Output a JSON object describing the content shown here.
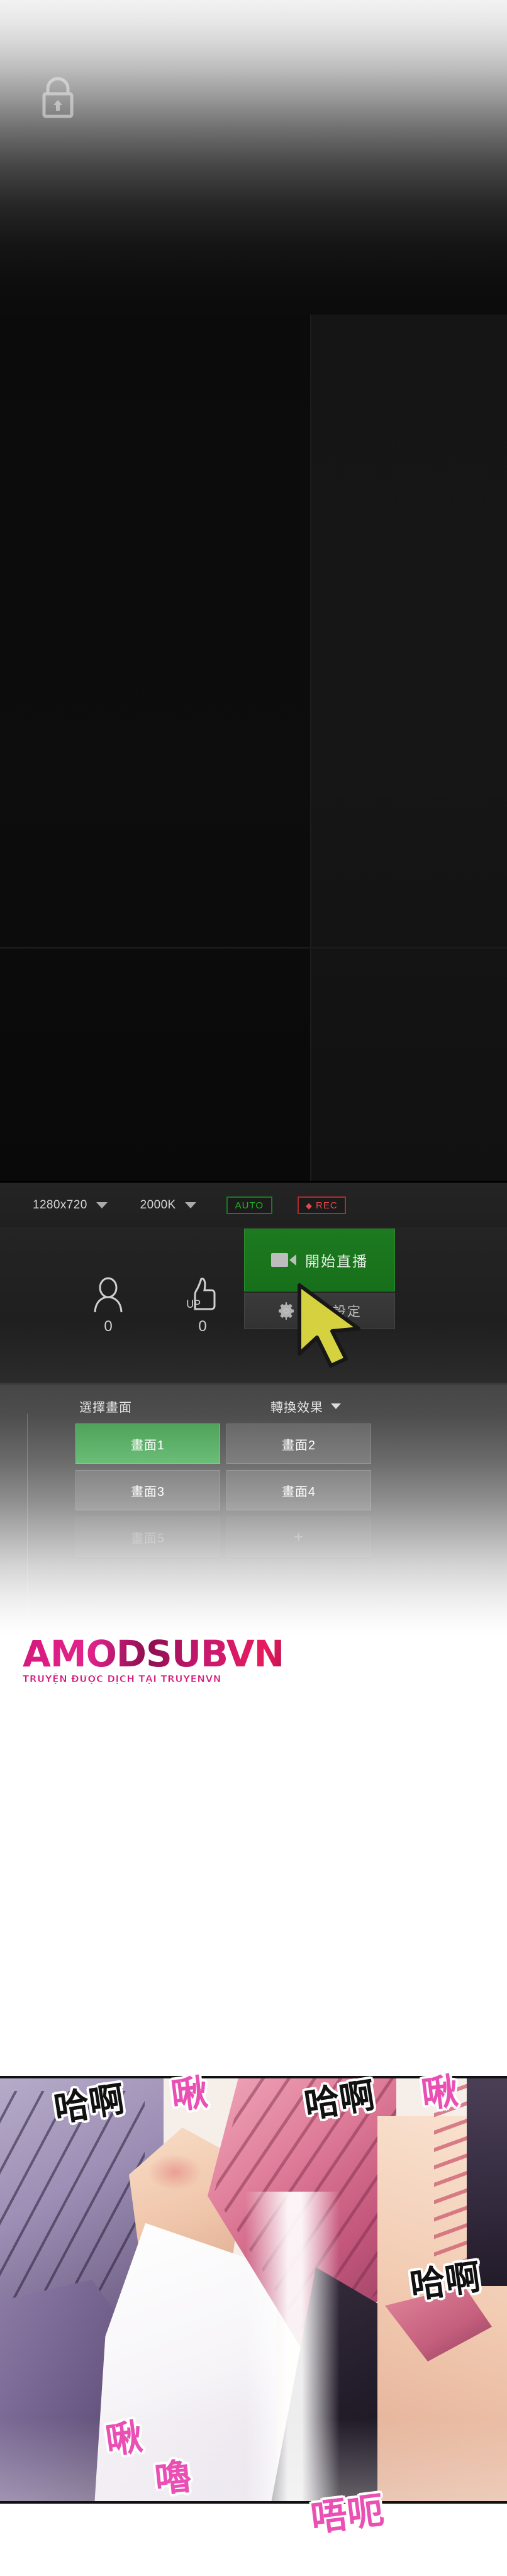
{
  "top_fade": {
    "lock_icon": "lock-icon"
  },
  "preview": {
    "note": ""
  },
  "toolbar": {
    "resolution": "1280x720",
    "bitrate": "2000K",
    "auto_label": "AUTO",
    "rec_label": "REC",
    "rec_dot": "◆",
    "caret_icon": "chevron-down-icon",
    "auto_color": "#21b324",
    "rec_color": "#e04a4a"
  },
  "stats": {
    "viewer": {
      "icon": "person-icon",
      "value": "0"
    },
    "like": {
      "icon": "thumbs-up-icon",
      "value": "0"
    }
  },
  "actions": {
    "go_live_label": "開始直播",
    "go_live_icon": "video-camera-icon",
    "go_live_color": "#1d7a1f",
    "settings_label": "直播設定",
    "settings_icon": "gear-icon",
    "cursor_icon": "mouse-cursor-arrow"
  },
  "scene_panel": {
    "select_label": "選擇畫面",
    "transition_label": "轉換效果",
    "caret_icon": "chevron-down-icon",
    "active_color": "#6bbd77",
    "scenes": [
      {
        "label": "畫面1",
        "active": true,
        "faint": false
      },
      {
        "label": "畫面2",
        "active": false,
        "faint": false
      },
      {
        "label": "畫面3",
        "active": false,
        "faint": false
      },
      {
        "label": "畫面4",
        "active": false,
        "faint": false
      },
      {
        "label": "畫面5",
        "active": false,
        "faint": true
      },
      {
        "label": "+",
        "active": false,
        "faint": true
      }
    ]
  },
  "watermark": {
    "title": "AMODSUBVN",
    "subtitle": "TRUYỆN ĐƯỢC DỊCH TẠI TRUYENVN",
    "color": "#d6197e"
  },
  "comic": {
    "sfx": [
      {
        "text": "哈啊",
        "color": "black"
      },
      {
        "text": "啾",
        "color": "pink"
      },
      {
        "text": "哈啊",
        "color": "black"
      },
      {
        "text": "啾",
        "color": "pink"
      },
      {
        "text": "哈啊",
        "color": "black"
      },
      {
        "text": "啾",
        "color": "pink"
      },
      {
        "text": "嚕",
        "color": "pink"
      },
      {
        "text": "唔呃",
        "color": "pink"
      }
    ]
  }
}
